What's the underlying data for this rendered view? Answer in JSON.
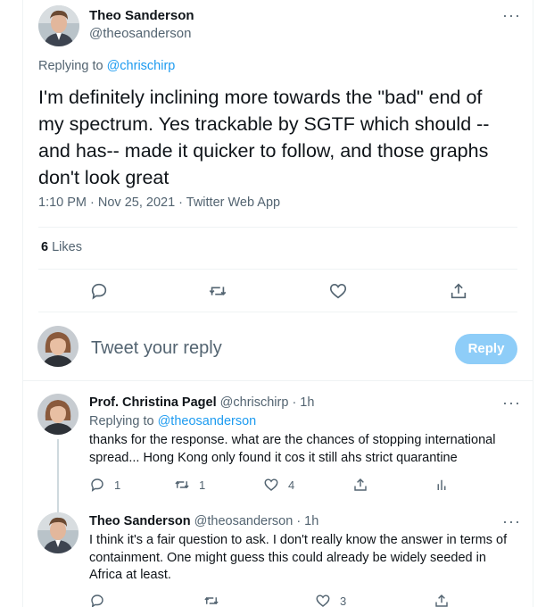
{
  "main_tweet": {
    "author_name": "Theo Sanderson",
    "author_handle": "@theosanderson",
    "replying_prefix": "Replying to ",
    "replying_to": "@chrischirp",
    "text": "I'm definitely inclining more towards the \"bad\" end of my spectrum. Yes trackable by SGTF which should -- and has-- made it quicker to follow, and those graphs don't look great",
    "timestamp": "1:10 PM · Nov 25, 2021 · Twitter Web App",
    "likes_count": "6",
    "likes_label": "Likes",
    "more_glyph": "···"
  },
  "reply_box": {
    "placeholder": "Tweet your reply",
    "button_label": "Reply"
  },
  "replies": [
    {
      "author_name": "Prof. Christina Pagel",
      "author_handle": "@chrischirp",
      "time": "· 1h",
      "replying_prefix": "Replying to ",
      "replying_to": "@theosanderson",
      "text": "thanks for the response. what are the chances of stopping international spread... Hong Kong only found it cos it still ahs strict quarantine",
      "reply_count": "1",
      "retweet_count": "1",
      "like_count": "4",
      "more_glyph": "···"
    },
    {
      "author_name": "Theo Sanderson",
      "author_handle": "@theosanderson",
      "time": "· 1h",
      "text": "I think it's a fair question to ask. I don't really know the answer in terms of containment. One might guess this could already be widely seeded in Africa at least.",
      "like_count": "3",
      "more_glyph": "···"
    }
  ],
  "colors": {
    "accent": "#1d9bf0",
    "reply_button_disabled": "#8ecdf8",
    "secondary_text": "#536471",
    "divider": "#eff3f4"
  },
  "icons": {
    "reply": "comment-icon",
    "retweet": "retweet-icon",
    "like": "heart-icon",
    "share": "share-icon",
    "analytics": "analytics-icon",
    "more": "more-dots-icon"
  }
}
